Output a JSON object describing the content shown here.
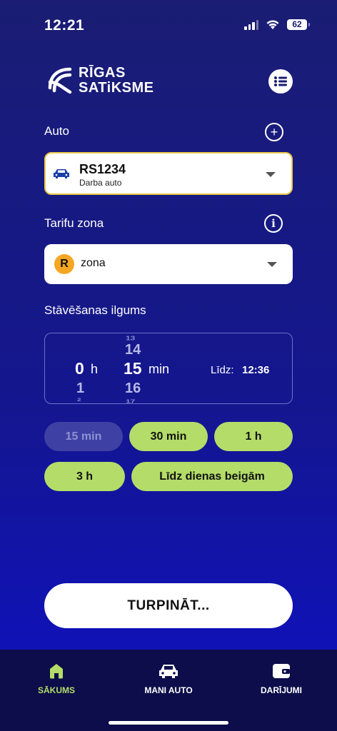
{
  "status": {
    "time": "12:21",
    "battery": "62"
  },
  "logo": {
    "line1": "RĪGAS",
    "line2": "SATiKSME"
  },
  "auto": {
    "label": "Auto",
    "plate": "RS1234",
    "description": "Darba auto"
  },
  "zone": {
    "label": "Tarifu zona",
    "badge": "R",
    "name": "zona"
  },
  "duration": {
    "label": "Stāvēšanas ilgums",
    "hours": "0",
    "hours_unit": "h",
    "hours_next": "1",
    "hours_next2": "2",
    "minutes": "15",
    "minutes_unit": "min",
    "minutes_prev2": "13",
    "minutes_prev": "14",
    "minutes_next": "16",
    "minutes_next2": "17",
    "until_label": "Līdz:",
    "until_time": "12:36"
  },
  "presets": {
    "p15": "15 min",
    "p30": "30 min",
    "p1h": "1 h",
    "p3h": "3 h",
    "end_of_day": "Līdz dienas beigām"
  },
  "continue_label": "TURPINĀT...",
  "tabs": {
    "home": "SĀKUMS",
    "cars": "MANI AUTO",
    "transactions": "DARĪJUMI"
  },
  "colors": {
    "accent_green": "#b3dd68",
    "zone_orange": "#f5a623",
    "background": "#1a1d73"
  }
}
